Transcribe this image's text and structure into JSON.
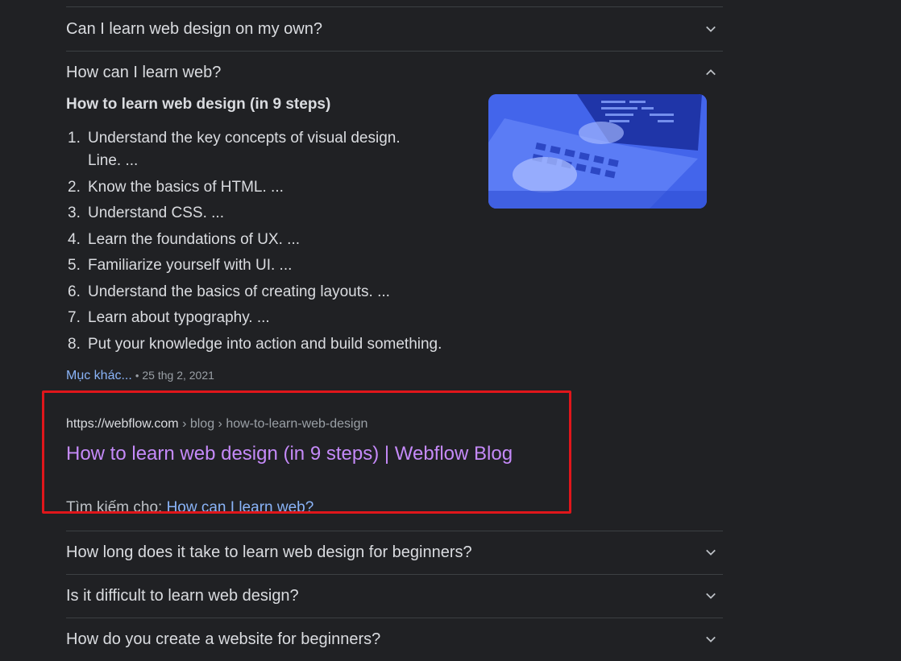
{
  "faq": {
    "q1": "Can I learn web design on my own?",
    "q2": "How can I learn web?",
    "q3": "How long does it take to learn web design for beginners?",
    "q4": "Is it difficult to learn web design?",
    "q5": "How do you create a website for beginners?"
  },
  "answer": {
    "title": "How to learn web design (in 9 steps)",
    "steps": [
      {
        "num": "1.",
        "text": "Understand the key concepts of visual design.",
        "text2": "Line. ..."
      },
      {
        "num": "2.",
        "text": "Know the basics of HTML. ..."
      },
      {
        "num": "3.",
        "text": "Understand CSS. ..."
      },
      {
        "num": "4.",
        "text": "Learn the foundations of UX. ..."
      },
      {
        "num": "5.",
        "text": "Familiarize yourself with UI. ..."
      },
      {
        "num": "6.",
        "text": "Understand the basics of creating layouts. ..."
      },
      {
        "num": "7.",
        "text": "Learn about typography. ..."
      },
      {
        "num": "8.",
        "text": "Put your knowledge into action and build something."
      }
    ],
    "more_link": "Mục khác...",
    "bullet": "•",
    "date": "25 thg 2, 2021"
  },
  "source": {
    "host": "https://webflow.com",
    "path": " › blog › how-to-learn-web-design",
    "title": "How to learn web design (in 9 steps) | Webflow Blog"
  },
  "search_for": {
    "label": "Tìm kiếm cho: ",
    "query": "How can I learn web?"
  },
  "colors": {
    "background": "#202124",
    "link_visited": "#c58af9",
    "link": "#8ab4f8",
    "highlight_box": "#e0161b"
  },
  "icons": {
    "collapsed": "chevron-down-icon",
    "expanded": "chevron-up-icon"
  }
}
